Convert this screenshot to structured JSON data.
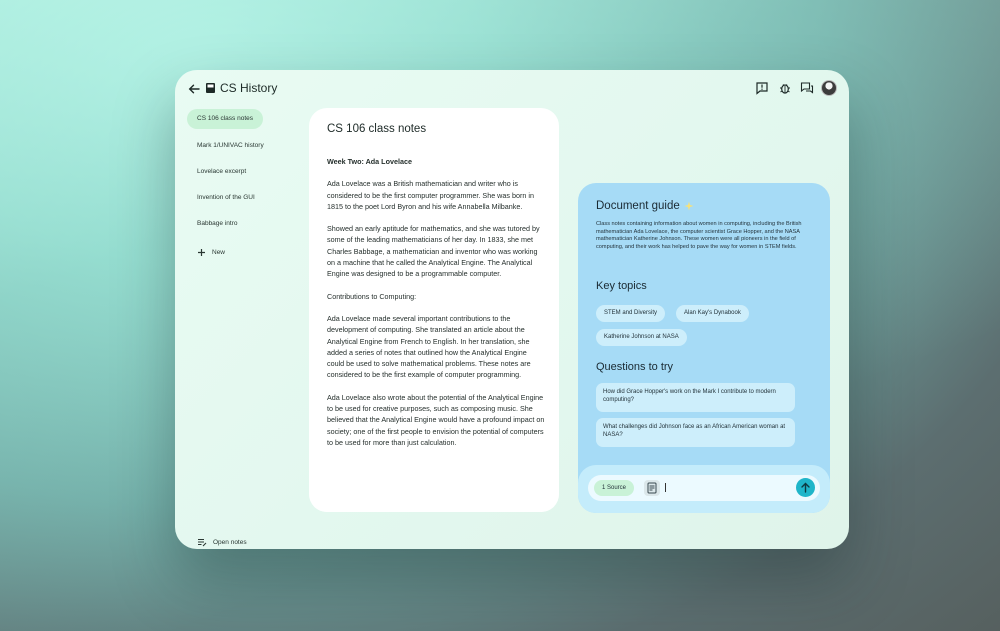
{
  "app": {
    "title": "CS History"
  },
  "sidebar": {
    "items": [
      {
        "label": "CS 106 class notes",
        "active": true
      },
      {
        "label": "Mark 1/UNIVAC history",
        "active": false
      },
      {
        "label": "Lovelace excerpt",
        "active": false
      },
      {
        "label": "Invention of the GUI",
        "active": false
      },
      {
        "label": "Babbage intro",
        "active": false
      }
    ],
    "new_label": "New",
    "open_notes_label": "Open notes"
  },
  "notes": {
    "title": "CS 106 class notes",
    "heading": "Week Two: Ada Lovelace",
    "paragraphs": [
      "Ada Lovelace was a British mathematician and writer who is considered to be the first computer programmer. She was born in 1815 to the poet Lord Byron and his wife Annabella Milbanke.",
      "Showed an early aptitude for mathematics, and she was tutored by some of the leading mathematicians of her day. In 1833, she met Charles Babbage, a mathematician and inventor who was working on a machine that he called the Analytical Engine. The Analytical Engine was designed to be a programmable computer.",
      "Contributions to Computing:",
      "Ada Lovelace made several important contributions to the development of computing. She translated an article about the Analytical Engine from French to English. In her translation, she added a series of notes that outlined how the Analytical Engine could be used to solve mathematical problems. These notes are considered to be the first example of computer programming.",
      "Ada Lovelace also wrote about the potential of the Analytical Engine to be used for creative purposes, such as composing music. She believed that the Analytical Engine would have a profound impact on society; one of the first people to envision the potential of computers to be used for more than just calculation."
    ]
  },
  "guide": {
    "title": "Document guide",
    "description": "Class notes containing information about women in computing, including the British mathematician Ada Lovelace, the computer scientist Grace Hopper, and the NASA mathematician Katherine Johnson. These women were all pioneers in the field of computing, and their work has helped to pave the way for women in STEM fields.",
    "topics_heading": "Key topics",
    "topics": [
      "STEM and Diversity",
      "Alan Kay's Dynabook",
      "Katherine Johnson at NASA"
    ],
    "questions_heading": "Questions to try",
    "questions": [
      "How did Grace Hopper's work on the Mark I contribute to modern computing?",
      "What challenges did Johnson face as an African American woman at NASA?"
    ]
  },
  "input": {
    "source_label": "1 Source",
    "value": ""
  },
  "colors": {
    "accent": "#1fb5c9",
    "guide_bg": "#a6dbf6",
    "active_item": "#c9f2d7"
  }
}
